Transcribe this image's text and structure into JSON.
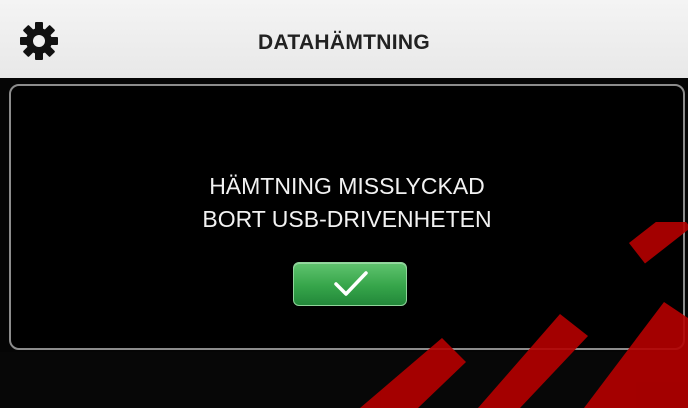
{
  "header": {
    "title": "DATAHÄMTNING",
    "settings_icon": "gear-icon"
  },
  "dialog": {
    "message_line_1": "HÄMTNING MISSLYCKAD",
    "message_line_2": "BORT USB-DRIVENHETEN",
    "confirm_icon": "checkmark-icon"
  },
  "colors": {
    "header_bg": "#f0f0f0",
    "screen_bg": "#000000",
    "button_green": "#3aa74c",
    "text_light": "#f2f2f2",
    "watermark_red": "#b50000"
  }
}
